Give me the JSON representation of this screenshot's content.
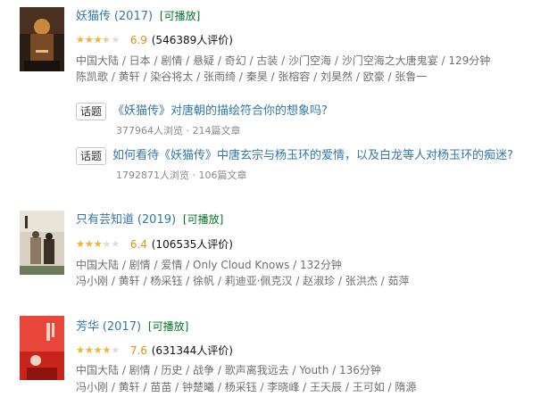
{
  "movies": [
    {
      "title": "妖猫传",
      "year": "(2017)",
      "playable": "[可播放]",
      "rating": 6.9,
      "rating_text": "6.9",
      "votes": "(546389人评价)",
      "meta_line1": "中国大陆 / 日本 / 剧情 / 悬疑 / 奇幻 / 古装 / 沙门空海 / 沙门空海之大唐鬼宴 / 129分钟",
      "meta_line2": "陈凯歌 / 黄轩 / 染谷将太 / 张雨绮 / 秦昊 / 张榕容 / 刘昊然 / 欧豪 / 张鲁一",
      "poster_colors": [
        "#2a1d14",
        "#7a4a26",
        "#c98a3e"
      ],
      "topics": [
        {
          "tag": "话题",
          "title": "《妖猫传》对唐朝的描绘符合你的想象吗?",
          "stats": "377964人浏览 · 214篇文章"
        },
        {
          "tag": "话题",
          "title": "如何看待《妖猫传》中唐玄宗与杨玉环的爱情，以及白龙等人对杨玉环的痴迷?",
          "stats": "1792871人浏览 · 106篇文章"
        }
      ]
    },
    {
      "title": "只有芸知道",
      "year": "(2019)",
      "playable": "[可播放]",
      "rating": 6.4,
      "rating_text": "6.4",
      "votes": "(106535人评价)",
      "meta_line1": "中国大陆 / 剧情 / 爱情 / Only Cloud Knows / 132分钟",
      "meta_line2": "冯小刚 / 黄轩 / 杨采钰 / 徐帆 / 莉迪亚·佩克汉 / 赵淑珍 / 张洪杰 / 茹萍",
      "poster_colors": [
        "#d9d2c2",
        "#8a7a62",
        "#3b3028"
      ],
      "topics": []
    },
    {
      "title": "芳华",
      "year": "(2017)",
      "playable": "[可播放]",
      "rating": 7.6,
      "rating_text": "7.6",
      "votes": "(631344人评价)",
      "meta_line1": "中国大陆 / 剧情 / 历史 / 战争 / 歌声离我远去 / Youth / 136分钟",
      "meta_line2": "冯小刚 / 黄轩 / 苗苗 / 钟楚曦 / 杨采钰 / 李晓峰 / 王天辰 / 王可如 / 隋源",
      "poster_colors": [
        "#c8231d",
        "#e8463a",
        "#f2d3c2"
      ],
      "topics": []
    }
  ],
  "icons": {
    "star": "star-icon"
  }
}
